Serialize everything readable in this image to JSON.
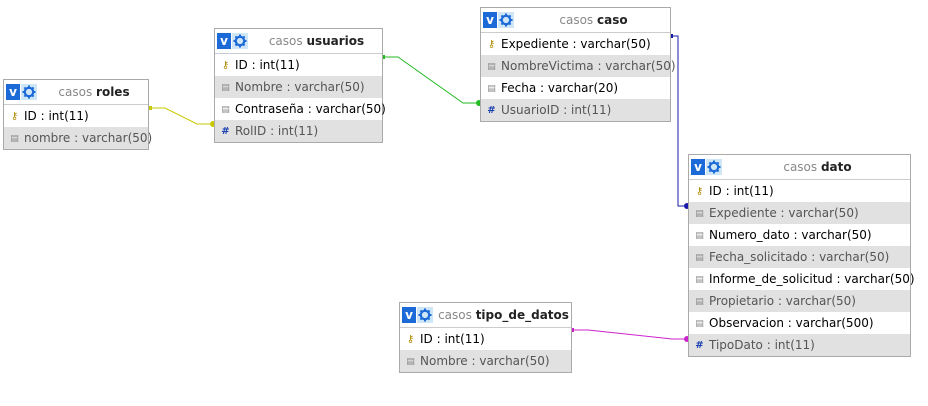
{
  "tables": [
    {
      "id": "roles",
      "db": "casos",
      "name": "roles",
      "rows": [
        {
          "icon": "key",
          "text": "ID : int(11)"
        },
        {
          "icon": "col",
          "text": "nombre : varchar(50)"
        }
      ]
    },
    {
      "id": "usuarios",
      "db": "casos",
      "name": "usuarios",
      "rows": [
        {
          "icon": "key",
          "text": "ID : int(11)"
        },
        {
          "icon": "col",
          "text": "Nombre : varchar(50)"
        },
        {
          "icon": "col",
          "text": "Contraseña : varchar(50)"
        },
        {
          "icon": "idx",
          "text": "RolID : int(11)"
        }
      ]
    },
    {
      "id": "caso",
      "db": "casos",
      "name": "caso",
      "rows": [
        {
          "icon": "key",
          "text": "Expediente : varchar(50)"
        },
        {
          "icon": "col",
          "text": "NombreVictima : varchar(50)"
        },
        {
          "icon": "col",
          "text": "Fecha : varchar(20)"
        },
        {
          "icon": "idx",
          "text": "UsuarioID : int(11)"
        }
      ]
    },
    {
      "id": "dato",
      "db": "casos",
      "name": "dato",
      "rows": [
        {
          "icon": "key",
          "text": "ID : int(11)"
        },
        {
          "icon": "col",
          "text": "Expediente : varchar(50)"
        },
        {
          "icon": "col",
          "text": "Numero_dato : varchar(50)"
        },
        {
          "icon": "col",
          "text": "Fecha_solicitado : varchar(50)"
        },
        {
          "icon": "col",
          "text": "Informe_de_solicitud : varchar(50)"
        },
        {
          "icon": "col",
          "text": "Propietario : varchar(50)"
        },
        {
          "icon": "col",
          "text": "Observacion : varchar(500)"
        },
        {
          "icon": "idx",
          "text": "TipoDato : int(11)"
        }
      ]
    },
    {
      "id": "tipo_de_datos",
      "db": "casos",
      "name": "tipo_de_datos",
      "rows": [
        {
          "icon": "key",
          "text": "ID : int(11)"
        },
        {
          "icon": "col",
          "text": "Nombre : varchar(50)"
        }
      ]
    }
  ],
  "header_buttons": {
    "v_label": "v"
  },
  "link_colors": {
    "roles_usuarios": "#c8c800",
    "usuarios_caso": "#22bb22",
    "caso_dato": "#1a1aaa",
    "tipo_dato": "#cc22cc"
  }
}
